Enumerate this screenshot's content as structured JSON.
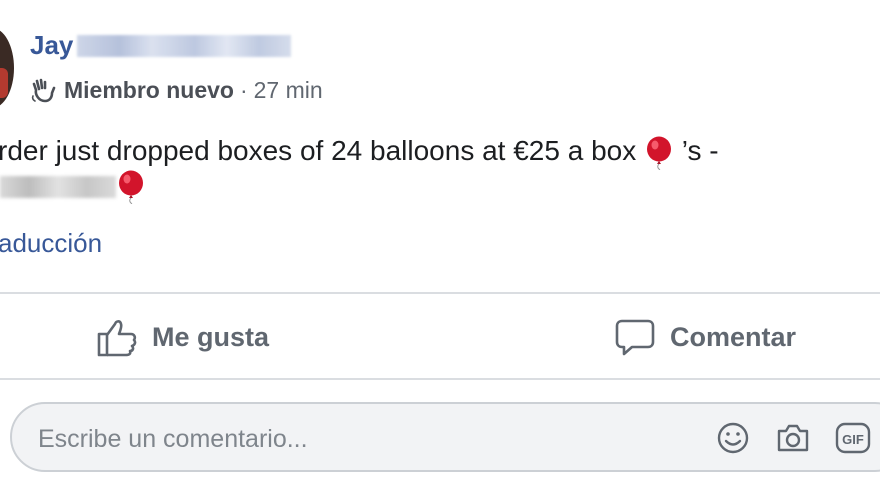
{
  "post": {
    "author_name": "Jay",
    "role_badge": "Miembro nuevo",
    "separator": "·",
    "time": "27 min",
    "text_line1": "rder just dropped boxes of 24 balloons at €25 a box",
    "text_line1_suffix": "’s -",
    "translate_link": "aducción"
  },
  "actions": {
    "like_label": "Me gusta",
    "comment_label": "Comentar"
  },
  "comment_box": {
    "placeholder": "Escribe un comentario..."
  },
  "icons": {
    "balloon_color": "#d2142b",
    "link_color": "#385898"
  }
}
